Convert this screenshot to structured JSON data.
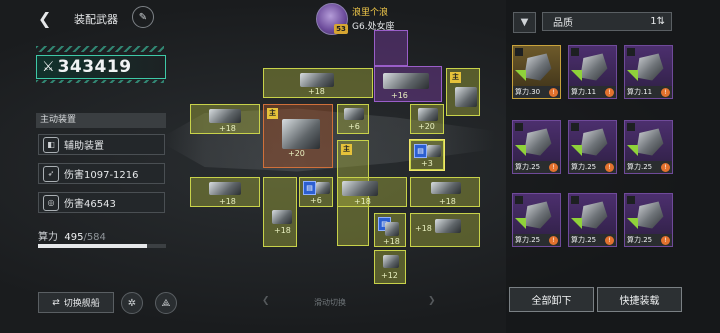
{
  "header": {
    "back_icon": "back-arrow-icon",
    "title": "装配武器",
    "edit_icon": "pencil-icon"
  },
  "power": {
    "value": "343419"
  },
  "panel": {
    "section_title": "主动装置",
    "stats": [
      {
        "icon": "device-icon",
        "label": "辅助装置"
      },
      {
        "icon": "damage-icon",
        "label": "伤害1097-1216"
      },
      {
        "icon": "shield-icon",
        "label": "伤害46543"
      }
    ],
    "capacity": {
      "label": "算力",
      "used": "495",
      "total": "/584",
      "fraction": 0.848
    }
  },
  "bottom": {
    "switch_ship": "切换舰船",
    "slide_hint": "滑动切换"
  },
  "player": {
    "name": "浪里个浪",
    "nick": "G6.处女座",
    "level": "53"
  },
  "slots": [
    {
      "lv": "+18"
    },
    {
      "lv": "+16"
    },
    {
      "lv": "+18"
    },
    {
      "lv": "+20"
    },
    {
      "lv": "+6"
    },
    {
      "lv": "+20"
    },
    {
      "lv": "+3"
    },
    {
      "lv": "+18"
    },
    {
      "lv": "+6"
    },
    {
      "lv": "+18"
    },
    {
      "lv": "+18"
    },
    {
      "lv": "+18"
    },
    {
      "lv": "+18"
    },
    {
      "lv": "+18"
    },
    {
      "lv": "+12"
    }
  ],
  "tags": {
    "gold": "主"
  },
  "inventory": {
    "filter_icon": "filter-icon",
    "sort_label": "品质",
    "sort_icon": "sort-toggle-icon",
    "cards": [
      {
        "power": "算力.30"
      },
      {
        "power": "算力.11"
      },
      {
        "power": "算力.11"
      },
      {
        "power": "算力.25"
      },
      {
        "power": "算力.25"
      },
      {
        "power": "算力.25"
      },
      {
        "power": "算力.25"
      },
      {
        "power": "算力.25"
      },
      {
        "power": "算力.25"
      }
    ],
    "unequip_all": "全部卸下",
    "quick_equip": "快捷装载"
  },
  "colors": {
    "accent": "#3ec9a7",
    "yellow_slot": "#c8d24a",
    "purple_slot": "#9a5ec9",
    "orange_slot": "#d0703a"
  }
}
